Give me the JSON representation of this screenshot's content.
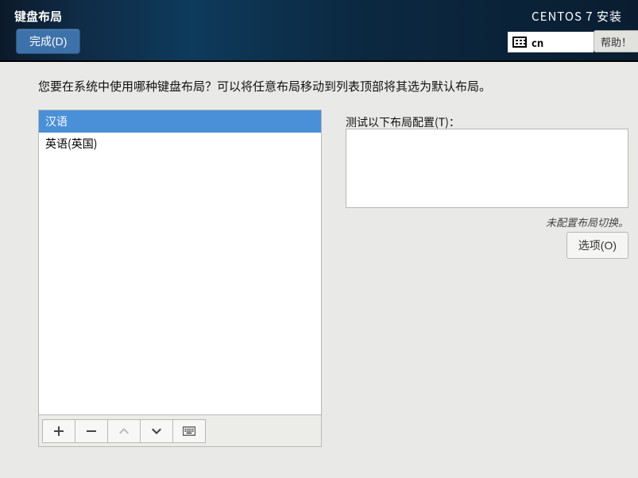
{
  "header": {
    "title": "键盘布局",
    "done_label": "完成(D)",
    "installer_title": "CENTOS 7 安装",
    "current_layout_code": "cn",
    "help_label": "帮助！"
  },
  "prompt": "您要在系统中使用哪种键盘布局？可以将任意布局移动到列表顶部将其选为默认布局。",
  "layouts": {
    "items": [
      {
        "label": "汉语",
        "selected": true
      },
      {
        "label": "英语(英国)",
        "selected": false
      }
    ]
  },
  "toolbar": {
    "add": "+",
    "remove": "−",
    "move_up": "up",
    "move_down": "down",
    "preview": "keyboard"
  },
  "test": {
    "label": "测试以下布局配置(T)：",
    "value": ""
  },
  "switch_note": "未配置布局切换。",
  "options_label": "选项(O)"
}
